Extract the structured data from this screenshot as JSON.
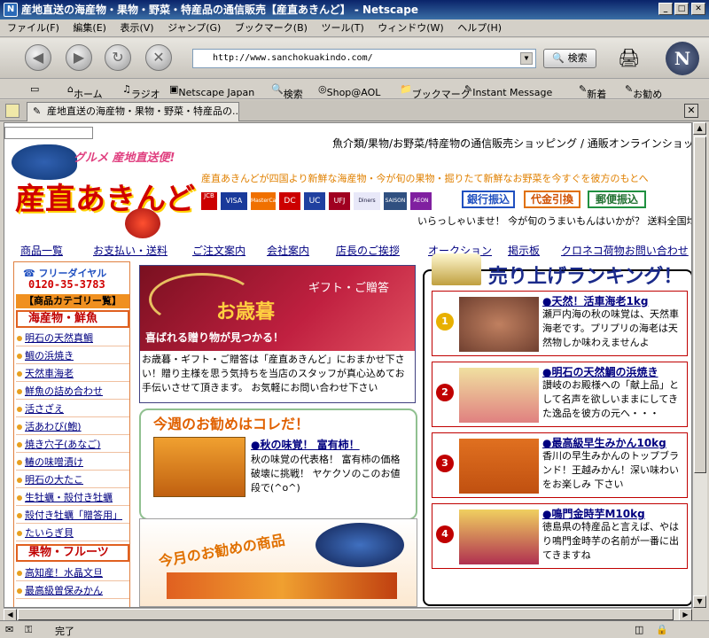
{
  "window": {
    "title": "産地直送の海産物・果物・野菜・特産品の通信販売【産直あきんど】 - Netscape"
  },
  "menu": [
    "ファイル(F)",
    "編集(E)",
    "表示(V)",
    "ジャンプ(G)",
    "ブックマーク(B)",
    "ツール(T)",
    "ウィンドウ(W)",
    "ヘルプ(H)"
  ],
  "toolbar": {
    "url": "http://www.sanchokuakindo.com/",
    "search_label": "検索",
    "logo": "N"
  },
  "personal": {
    "home": "ホーム",
    "radio": "ラジオ",
    "netscape_japan": "Netscape Japan",
    "search": "検索",
    "shop": "Shop@AOL",
    "bookmarks": "ブックマーク",
    "instant_message": "Instant Message",
    "shinchaku": "新着",
    "osusume": "お勧め"
  },
  "tab": {
    "title": "産地直送の海産物・果物・野菜・特産品の..."
  },
  "page": {
    "tagline": "魚介類/果物/お野菜/特産物の通信販売ショッピング / 通販オンラインショップ",
    "logo_sub": "グルメ 産地直送便!",
    "logo_main": "産直あきんど",
    "intro": "産直あきんどが四国より新鮮な海産物・今が旬の果物・掘りたて新鮮なお野菜を今すぐを彼方のもとへ",
    "cards": [
      "VISA",
      "MasterCard",
      "DC",
      "UC",
      "UFJ",
      "Diners",
      "SAISON",
      "AEON"
    ],
    "pay": [
      "銀行振込",
      "代金引換",
      "郵便振込"
    ],
    "welcome": "いらっしゃいませ！ 今が旬のうまいもんはいかが？ 送料全国均",
    "nav": [
      "商品一覧",
      "お支払い・送料",
      "ご注文案内",
      "会社案内",
      "店長のご挨拶",
      "オークション",
      "掲示板",
      "クロネコ荷物お問い合わせ"
    ],
    "freedial": {
      "label": "フリーダイヤル",
      "number": "0120-35-3783"
    },
    "category_header": "【商品カテゴリー覧】",
    "cat1": "海産物・鮮魚",
    "cat1_items": [
      "明石の天然真鯛",
      "鯛の浜焼き",
      "天然車海老",
      "鮮魚の詰め合わせ",
      "活さざえ",
      "活あわび(鮑)",
      "焼き穴子(あなご)",
      "鰆の味噌漬け",
      "明石の大たこ",
      "生牡蠣・殻付き牡蠣",
      "殻付き牡蠣「贈答用」",
      "たいらぎ貝"
    ],
    "cat2": "果物・フルーツ",
    "cat2_items": [
      "高知産！水晶文旦",
      "最高級曽保みかん"
    ],
    "oseibo_banner": "お歳暮",
    "oseibo_sub": "ギフト・ご贈答",
    "oseibo_tag": "喜ばれる贈り物が見つかる！",
    "oseibo_text": "お歳暮・ギフト・ご贈答は「産直あきんど」におまかせ下さい！贈り主様を思う気持ちを当店のスタッフが真心込めてお手伝いさせて頂きます。 お気軽にお問い合わせ下さい",
    "oseibo_highlight": "産直あきんど",
    "weekly": {
      "heading": "今週のお勧めはコレだ！",
      "item_title": "秋の味覚！ 富有柿！",
      "item_text": "秋の味覚の代表格！ 富有柿の価格破壊に挑戦！ ヤケクソのこのお値段で(^o^)"
    },
    "monthly": {
      "heading": "今月のお勧めの商品"
    },
    "ranking_title": "売り上げランキング！",
    "ranking": [
      {
        "rank": "1",
        "title": "天然！活車海老1kg",
        "text": "瀬戸内海の秋の味覚は、天然車海老です。プリプリの海老は天然物しか味わえませんよ"
      },
      {
        "rank": "2",
        "title": "明石の天然鯛の浜焼き",
        "text": "讃岐のお殿様への「献上品」として名声を欲しいままにしてきた逸品を彼方の元へ・・・"
      },
      {
        "rank": "3",
        "title": "最高級早生みかん10kg",
        "text": "香川の早生みかんのトップブランド！王越みかん！深い味わいをお楽しみ 下さい"
      },
      {
        "rank": "4",
        "title": "鳴門金時芋M10kg",
        "text": "徳島県の特産品と言えば、やはり鳴門金時芋の名前が一番に出てきますね"
      }
    ]
  },
  "status": {
    "text": "完了"
  }
}
